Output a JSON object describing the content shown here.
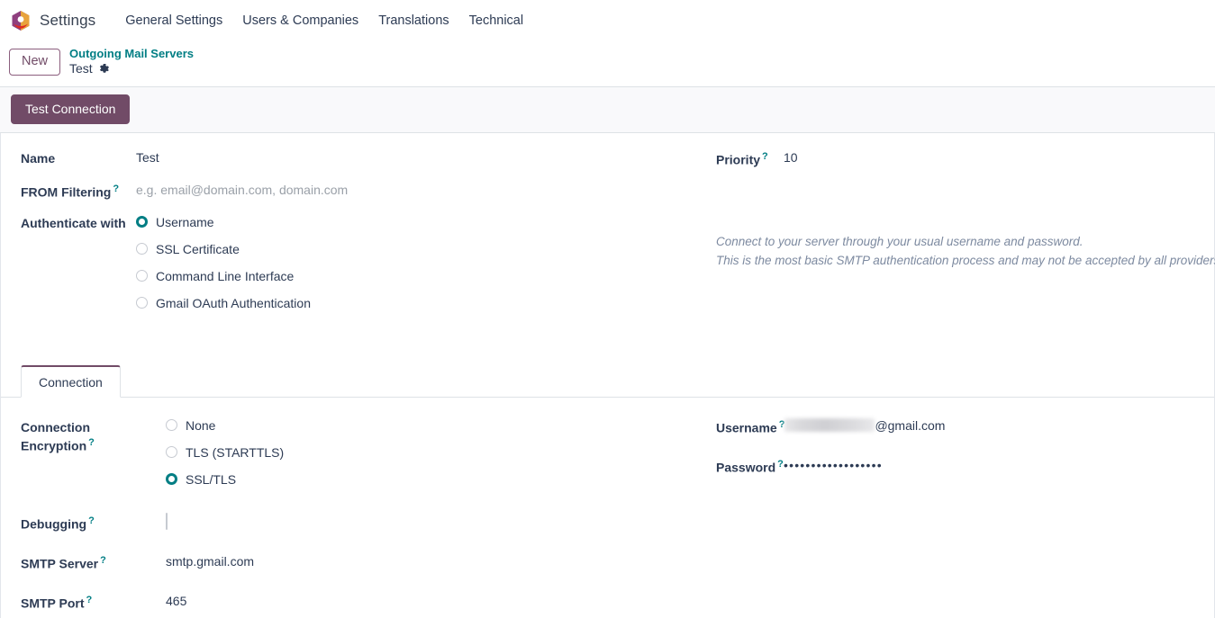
{
  "navbar": {
    "brand": "Settings",
    "logo_icon": "odoo-logo-icon",
    "menu": [
      {
        "label": "General Settings"
      },
      {
        "label": "Users & Companies"
      },
      {
        "label": "Translations"
      },
      {
        "label": "Technical"
      }
    ]
  },
  "breadcrumb": {
    "new_button": "New",
    "parent": "Outgoing Mail Servers",
    "current": "Test",
    "gear_icon": "gear-icon"
  },
  "control_panel": {
    "test_connection": "Test Connection"
  },
  "form": {
    "name": {
      "label": "Name",
      "value": "Test"
    },
    "from_filtering": {
      "label": "FROM Filtering",
      "help": "?",
      "placeholder": "e.g. email@domain.com, domain.com"
    },
    "authenticate_with": {
      "label": "Authenticate with",
      "selected": "Username",
      "options": [
        {
          "label": "Username",
          "checked": true
        },
        {
          "label": "SSL Certificate",
          "checked": false
        },
        {
          "label": "Command Line Interface",
          "checked": false
        },
        {
          "label": "Gmail OAuth Authentication",
          "checked": false
        }
      ]
    },
    "priority": {
      "label": "Priority",
      "help": "?",
      "value": "10"
    },
    "auth_hint": {
      "line1": "Connect to your server through your usual username and password.",
      "line2": "This is the most basic SMTP authentication process and may not be accepted by all providers."
    }
  },
  "notebook": {
    "tabs": [
      {
        "label": "Connection",
        "active": true
      }
    ],
    "connection": {
      "encryption": {
        "label_line1": "Connection",
        "label_line2": "Encryption",
        "help": "?",
        "selected": "SSL/TLS",
        "options": [
          {
            "label": "None",
            "checked": false
          },
          {
            "label": "TLS (STARTTLS)",
            "checked": false
          },
          {
            "label": "SSL/TLS",
            "checked": true
          }
        ]
      },
      "debugging": {
        "label": "Debugging",
        "help": "?",
        "checked": false
      },
      "smtp_server": {
        "label": "SMTP Server",
        "help": "?",
        "value": "smtp.gmail.com"
      },
      "smtp_port": {
        "label": "SMTP Port",
        "help": "?",
        "value": "465"
      },
      "username": {
        "label": "Username",
        "help": "?",
        "value_visible": "@gmail.com",
        "value_redacted": true
      },
      "password": {
        "label": "Password",
        "help": "?",
        "value": "••••••••••••••••••"
      }
    }
  },
  "colors": {
    "brand_purple": "#714B67",
    "link_teal": "#017e84",
    "text": "#2d3b54",
    "muted": "#7d8aa0",
    "panel_bg": "#f9f9fb",
    "border": "#dee2e6"
  }
}
